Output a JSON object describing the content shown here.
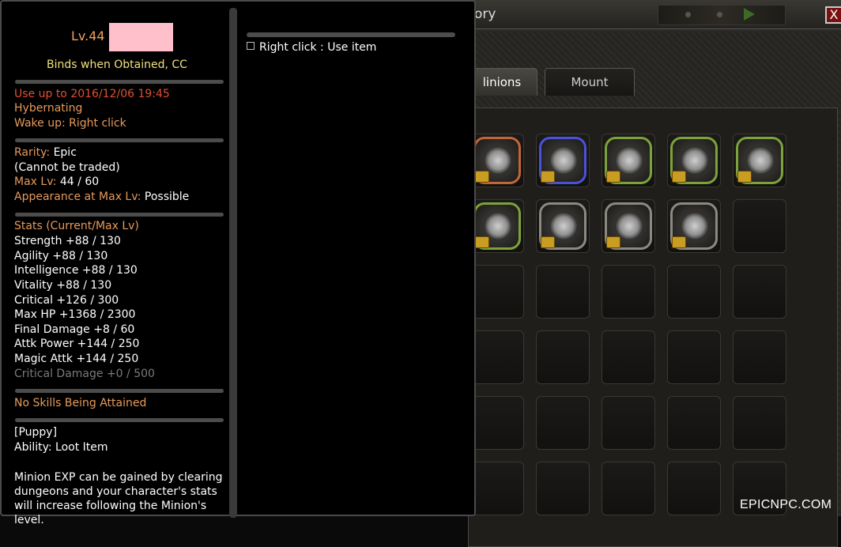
{
  "inventory": {
    "title": "ory",
    "close_glyph": "X",
    "tabs": [
      {
        "label": "linions",
        "active": true
      },
      {
        "label": "Mount",
        "active": false
      }
    ],
    "slots": [
      {
        "rarity": "legend",
        "filled": true
      },
      {
        "rarity": "rare",
        "filled": true
      },
      {
        "rarity": "uncommon",
        "filled": true
      },
      {
        "rarity": "uncommon",
        "filled": true
      },
      {
        "rarity": "uncommon",
        "filled": true
      },
      {
        "rarity": "uncommon",
        "filled": true
      },
      {
        "rarity": "normal",
        "filled": true
      },
      {
        "rarity": "normal",
        "filled": true
      },
      {
        "rarity": "normal",
        "filled": true
      },
      {
        "rarity": "",
        "filled": false
      },
      {
        "rarity": "",
        "filled": false
      },
      {
        "rarity": "",
        "filled": false
      },
      {
        "rarity": "",
        "filled": false
      },
      {
        "rarity": "",
        "filled": false
      },
      {
        "rarity": "",
        "filled": false
      },
      {
        "rarity": "",
        "filled": false
      },
      {
        "rarity": "",
        "filled": false
      },
      {
        "rarity": "",
        "filled": false
      },
      {
        "rarity": "",
        "filled": false
      },
      {
        "rarity": "",
        "filled": false
      },
      {
        "rarity": "",
        "filled": false
      },
      {
        "rarity": "",
        "filled": false
      },
      {
        "rarity": "",
        "filled": false
      },
      {
        "rarity": "",
        "filled": false
      },
      {
        "rarity": "",
        "filled": false
      },
      {
        "rarity": "",
        "filled": false
      },
      {
        "rarity": "",
        "filled": false
      },
      {
        "rarity": "",
        "filled": false
      },
      {
        "rarity": "",
        "filled": false
      },
      {
        "rarity": "",
        "filled": false
      }
    ]
  },
  "tooltip": {
    "level": "Lv.44",
    "binds": "Binds when Obtained, CC",
    "use_up_to": "Use up to 2016/12/06 19:45",
    "state": "Hybernating",
    "wake_label": "Wake up:",
    "wake_value": "Right click",
    "rarity_label": "Rarity:",
    "rarity_value": "Epic",
    "trade": "(Cannot be traded)",
    "maxlv_label": "Max Lv:",
    "maxlv_value": "44 / 60",
    "appearance_label": "Appearance at Max Lv:",
    "appearance_value": "Possible",
    "stats_header": "Stats (Current/Max Lv)",
    "stats": [
      "Strength +88 / 130",
      "Agility +88 / 130",
      "Intelligence +88 / 130",
      "Vitality +88 / 130",
      "Critical +126 / 300",
      "Max HP +1368 / 2300",
      "Final Damage +8 / 60",
      "Attk Power +144 / 250",
      "Magic Attk +144 / 250"
    ],
    "stat_disabled": "Critical Damage +0 / 500",
    "skills": "No Skills Being Attained",
    "type": "[Puppy]",
    "ability": "Ability: Loot Item",
    "desc": [
      "Minion EXP can be gained by clearing",
      "dungeons and your character's stats",
      "will increase following the Minion's",
      "level."
    ],
    "right_hint": "Right click : Use item"
  },
  "watermark": "EPICNPC.COM",
  "colors": {
    "orange": "#e79a5a",
    "red": "#e05030",
    "yellow": "#f0e080",
    "grey": "#7a7a7a",
    "pink_redaction": "#ffc0cb"
  }
}
